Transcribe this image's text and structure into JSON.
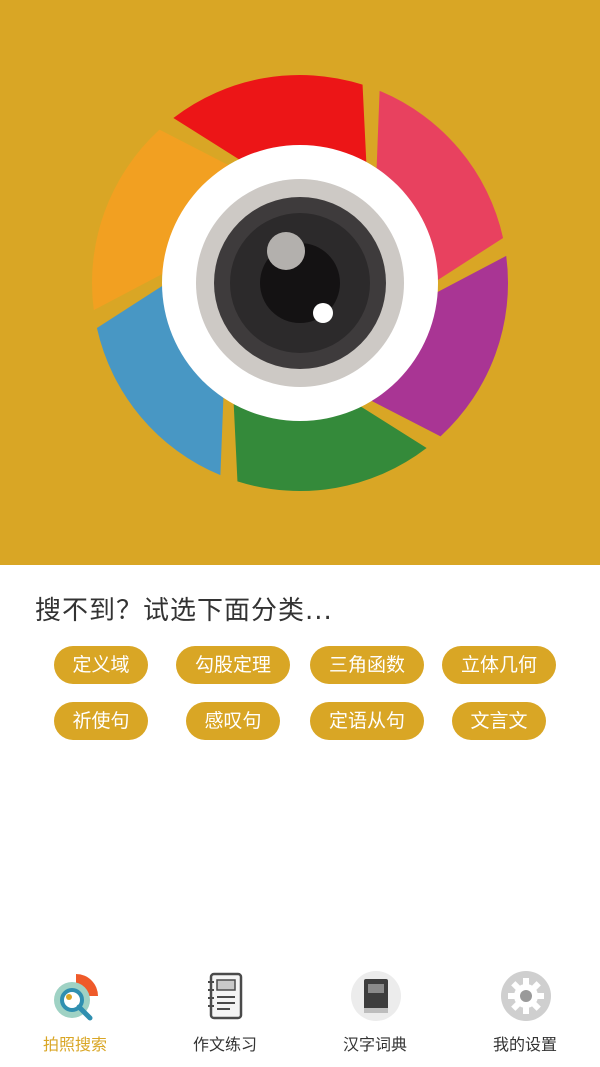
{
  "hero": {
    "icon": "camera-aperture-icon",
    "background_color": "#d9a625",
    "aperture_colors": [
      "#e8415f",
      "#a93594",
      "#348a3a",
      "#4897c4",
      "#f2a021",
      "#ec1517"
    ]
  },
  "search": {
    "prompt": "搜不到？试选下面分类..."
  },
  "categories": [
    {
      "label": "定义域"
    },
    {
      "label": "勾股定理"
    },
    {
      "label": "三角函数"
    },
    {
      "label": "立体几何"
    },
    {
      "label": "祈使句"
    },
    {
      "label": "感叹句"
    },
    {
      "label": "定语从句"
    },
    {
      "label": "文言文"
    }
  ],
  "tabbar": {
    "active_color": "#d9a625",
    "items": [
      {
        "label": "拍照搜索",
        "icon": "photo-search-icon",
        "active": true
      },
      {
        "label": "作文练习",
        "icon": "notebook-icon",
        "active": false
      },
      {
        "label": "汉字词典",
        "icon": "dictionary-book-icon",
        "active": false
      },
      {
        "label": "我的设置",
        "icon": "settings-gear-icon",
        "active": false
      }
    ]
  }
}
